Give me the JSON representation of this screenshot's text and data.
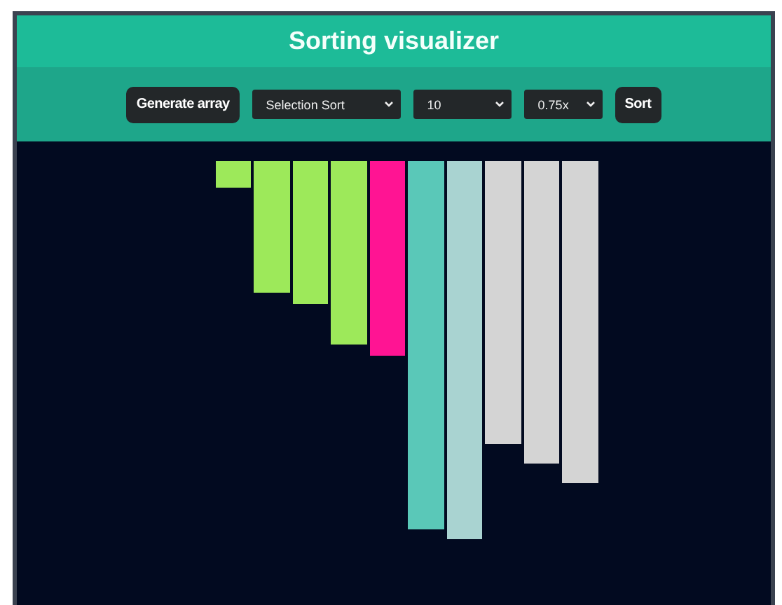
{
  "header": {
    "title": "Sorting visualizer"
  },
  "toolbar": {
    "generate_button": "Generate array",
    "algorithm": "Selection Sort",
    "size": "10",
    "speed": "0.75x",
    "sort_button": "Sort"
  },
  "bars": [
    {
      "level": 0.063,
      "color": "#9de95a"
    },
    {
      "level": 0.313,
      "color": "#9de95a"
    },
    {
      "level": 0.34,
      "color": "#9de95a"
    },
    {
      "level": 0.437,
      "color": "#9de95a"
    },
    {
      "level": 0.463,
      "color": "#ff1493"
    },
    {
      "level": 0.877,
      "color": "#5ac8b8"
    },
    {
      "level": 0.9,
      "color": "#a9d3d1"
    },
    {
      "level": 0.673,
      "color": "#d4d4d4"
    },
    {
      "level": 0.72,
      "color": "#d4d4d4"
    },
    {
      "level": 0.767,
      "color": "#d4d4d4"
    }
  ]
}
